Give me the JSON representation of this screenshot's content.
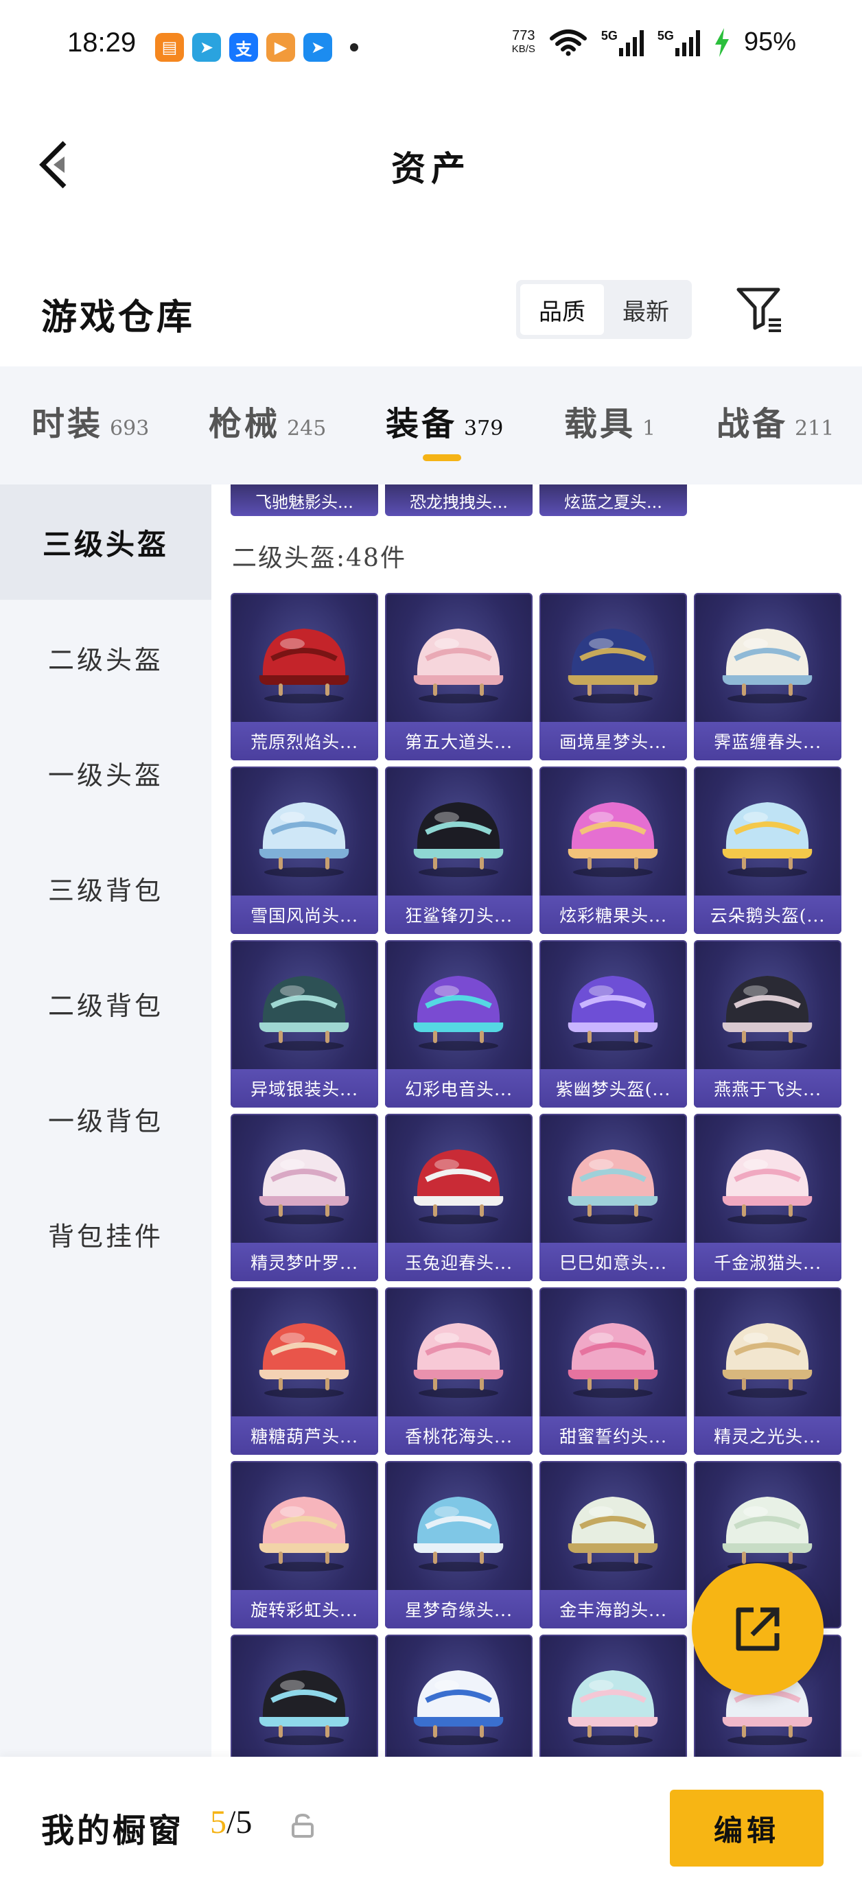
{
  "status": {
    "time": "18:29",
    "net_speed": "773",
    "net_unit": "KB/S",
    "battery": "95%",
    "apps": [
      {
        "icon": "books-app-icon",
        "color": "#f5871f",
        "glyph": "▤"
      },
      {
        "icon": "telegram-app-icon",
        "color": "#2aa3df",
        "glyph": "➤"
      },
      {
        "icon": "alipay-app-icon",
        "color": "#1677ff",
        "glyph": "支"
      },
      {
        "icon": "video-app-icon",
        "color": "#f29a3a",
        "glyph": "▶"
      },
      {
        "icon": "navigation-app-icon",
        "color": "#1c8cf0",
        "glyph": "➤"
      }
    ]
  },
  "header": {
    "title": "资产"
  },
  "warehouse": {
    "title": "游戏仓库",
    "sort_options": [
      "品质",
      "最新"
    ],
    "sort_active": "品质"
  },
  "tabs": [
    {
      "label": "时装",
      "count": "693"
    },
    {
      "label": "枪械",
      "count": "245"
    },
    {
      "label": "装备",
      "count": "379",
      "active": true
    },
    {
      "label": "载具",
      "count": "1"
    },
    {
      "label": "战备",
      "count": "211"
    }
  ],
  "sidebar": {
    "items": [
      "三级头盔",
      "二级头盔",
      "一级头盔",
      "三级背包",
      "二级背包",
      "一级背包",
      "背包挂件"
    ],
    "active": "三级头盔"
  },
  "content": {
    "top_strip": [
      "飞驰魅影头...",
      "恐龙拽拽头...",
      "炫蓝之夏头..."
    ],
    "section_label": "二级头盔:48件",
    "items": [
      {
        "name": "荒原烈焰头...",
        "colors": [
          "#c4242a",
          "#7a1414"
        ]
      },
      {
        "name": "第五大道头...",
        "colors": [
          "#f6d6dc",
          "#e9a9b5"
        ]
      },
      {
        "name": "画境星梦头...",
        "colors": [
          "#2c3b86",
          "#c7a85a"
        ]
      },
      {
        "name": "霁蓝缠春头...",
        "colors": [
          "#f3efe4",
          "#8fb9d6"
        ]
      },
      {
        "name": "雪国风尚头...",
        "colors": [
          "#cfe7f7",
          "#7fb0d8"
        ]
      },
      {
        "name": "狂鲨锋刃头...",
        "colors": [
          "#1c1c24",
          "#8fd7d3"
        ]
      },
      {
        "name": "炫彩糖果头...",
        "colors": [
          "#e56fd1",
          "#f3c27a"
        ]
      },
      {
        "name": "云朵鹅头盔(...",
        "colors": [
          "#bfe3f5",
          "#f4c84a"
        ]
      },
      {
        "name": "异域银装头...",
        "colors": [
          "#2d5155",
          "#9fd7d2"
        ]
      },
      {
        "name": "幻彩电音头...",
        "colors": [
          "#7a4bd2",
          "#55d8e3"
        ]
      },
      {
        "name": "紫幽梦头盔(...",
        "colors": [
          "#6e4fd6",
          "#c9b5ff"
        ]
      },
      {
        "name": "燕燕于飞头...",
        "colors": [
          "#2a2a34",
          "#d9c9d0"
        ]
      },
      {
        "name": "精灵梦叶罗...",
        "colors": [
          "#f4e7ee",
          "#d9a8c4"
        ]
      },
      {
        "name": "玉兔迎春头...",
        "colors": [
          "#c92b36",
          "#f1f1f1"
        ]
      },
      {
        "name": "巳巳如意头...",
        "colors": [
          "#f4b6b8",
          "#9fd0d9"
        ]
      },
      {
        "name": "千金淑猫头...",
        "colors": [
          "#f9e3ea",
          "#f0a8c0"
        ]
      },
      {
        "name": "糖糖葫芦头...",
        "colors": [
          "#e9554a",
          "#f4d2b4"
        ]
      },
      {
        "name": "香桃花海头...",
        "colors": [
          "#f7c9d6",
          "#e991ad"
        ]
      },
      {
        "name": "甜蜜誓约头...",
        "colors": [
          "#f0a8c7",
          "#e6739f"
        ]
      },
      {
        "name": "精灵之光头...",
        "colors": [
          "#f2e6cf",
          "#d8b77d"
        ]
      },
      {
        "name": "旋转彩虹头...",
        "colors": [
          "#f7b5bc",
          "#f2d4a8"
        ]
      },
      {
        "name": "星梦奇缘头...",
        "colors": [
          "#7fc7e6",
          "#e7f1f8"
        ]
      },
      {
        "name": "金丰海韵头...",
        "colors": [
          "#e7eee1",
          "#c4a85f"
        ]
      },
      {
        "name": "",
        "colors": [
          "#e8f1e6",
          "#c7dcc5"
        ]
      },
      {
        "name": "",
        "colors": [
          "#202026",
          "#8fd8ea"
        ]
      },
      {
        "name": "",
        "colors": [
          "#f0f4fb",
          "#3a6fcf"
        ]
      },
      {
        "name": "",
        "colors": [
          "#bfe7ea",
          "#f4c7d5"
        ]
      },
      {
        "name": "",
        "colors": [
          "#eaf0f6",
          "#f0b8c9"
        ]
      }
    ]
  },
  "bottom": {
    "showcase_label": "我的橱窗",
    "showcase_current": "5",
    "showcase_total": "/5",
    "edit_label": "编辑"
  }
}
